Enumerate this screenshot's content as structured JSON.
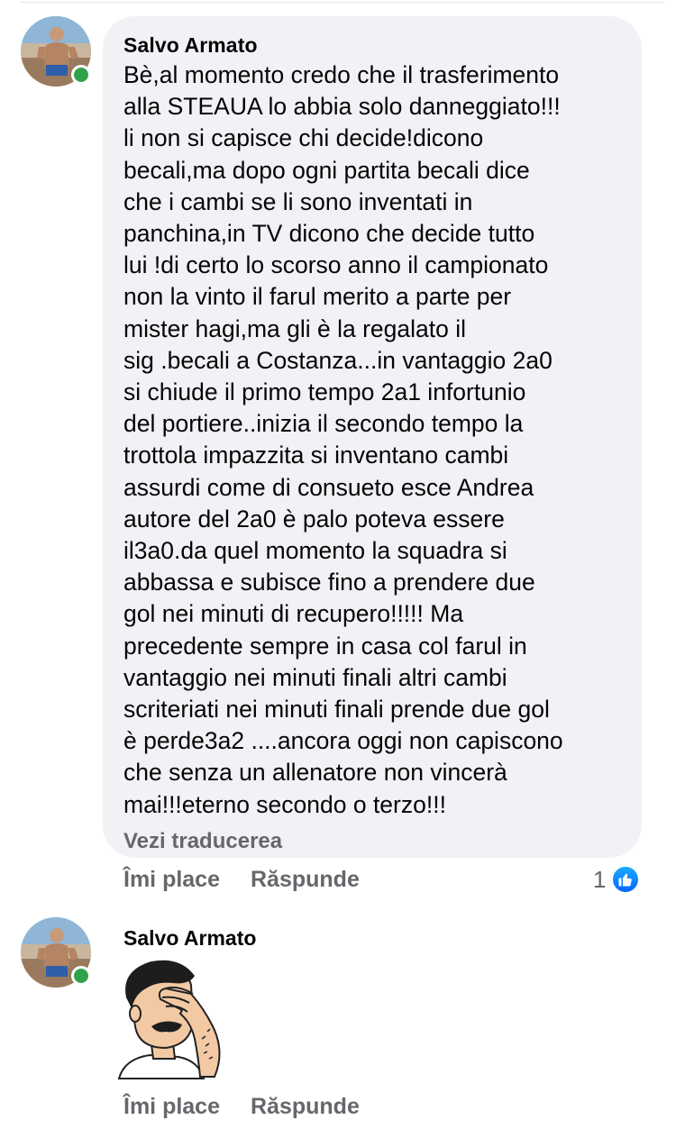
{
  "comments": [
    {
      "author": "Salvo Armato",
      "text": "Bè,al momento credo che il trasferimento\nalla STEAUA lo abbia solo danneggiato!!!\nli non si capisce chi decide!dicono\nbecali,ma dopo ogni partita becali dice\nche i cambi se li sono inventati in\npanchina,in TV dicono che decide tutto\nlui !di certo lo scorso anno il campionato\nnon la vinto il farul merito a parte per\nmister hagi,ma gli è la regalato il\nsig .becali a Costanza...in vantaggio 2a0\nsi chiude il primo tempo 2a1 infortunio\ndel portiere..inizia il secondo tempo la\ntrottola impazzita si inventano cambi\nassurdi come di consueto esce Andrea\nautore del 2a0 è palo poteva essere\nil3a0.da quel momento la squadra si\nabbassa e subisce fino a prendere due\ngol nei minuti di recupero!!!!! Ma\nprecedente sempre in casa col farul in\nvantaggio nei minuti finali altri cambi\nscriteriati nei minuti finali prende due gol\nè perde3a2 ....ancora oggi non capiscono\nche senza un allenatore non vincerà\nmai!!!eterno secondo o terzo!!!",
      "translate_label": "Vezi traducerea",
      "like_label": "Îmi place",
      "reply_label": "Răspunde",
      "reaction_count": "1",
      "reaction_icon": "like-icon",
      "online": true
    },
    {
      "author": "Salvo Armato",
      "sticker": "facepalm-sticker",
      "like_label": "Îmi place",
      "reply_label": "Răspunde",
      "online": true
    }
  ],
  "colors": {
    "bubble_bg": "#f0f2f5",
    "secondary_text": "#65676b",
    "online_green": "#31a24c",
    "like_blue": "#0866ff"
  }
}
